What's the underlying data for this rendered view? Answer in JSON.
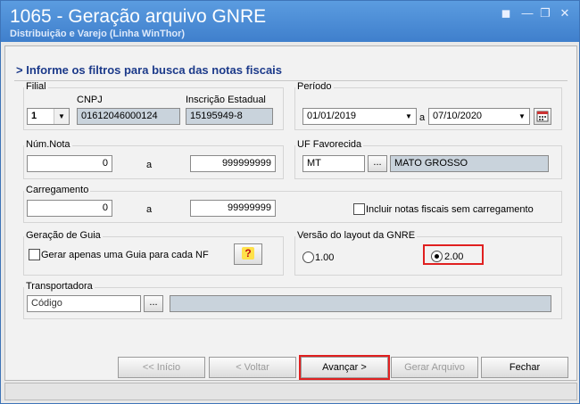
{
  "window": {
    "title": "1065 - Geração arquivo GNRE",
    "subtitle": "Distribuição e Varejo (Linha WinThor)",
    "controls": [
      "minimize",
      "restore",
      "close"
    ]
  },
  "heading": "> Informe os filtros para busca das notas fiscais",
  "filial": {
    "title": "Filial",
    "value": "1",
    "cnpj_label": "CNPJ",
    "cnpj_value": "01612046000124",
    "ie_label": "Inscrição Estadual",
    "ie_value": "15195949-8"
  },
  "periodo": {
    "title": "Período",
    "start": "01/01/2019",
    "sep": "a",
    "end": "07/10/2020"
  },
  "num_nota": {
    "title": "Núm.Nota",
    "from": "0",
    "sep": "a",
    "to": "999999999"
  },
  "uf": {
    "title": "UF Favorecida",
    "code": "MT",
    "button": "...",
    "name": "MATO GROSSO"
  },
  "carregamento": {
    "title": "Carregamento",
    "from": "0",
    "sep": "a",
    "to": "99999999",
    "include_label": "Incluir notas fiscais sem carregamento",
    "include_checked": false
  },
  "geracao": {
    "title": "Geração de Guia",
    "check_label": "Gerar apenas uma Guia para cada NF",
    "checked": false,
    "help_glyph": "?"
  },
  "versao": {
    "title": "Versão do layout da GNRE",
    "option1": "1.00",
    "option2": "2.00",
    "selected": "2.00"
  },
  "transportadora": {
    "title": "Transportadora",
    "placeholder": "Código",
    "button": "..."
  },
  "buttons": {
    "inicio": "<< Início",
    "voltar": "< Voltar",
    "avancar": "Avançar >",
    "gerar": "Gerar Arquivo",
    "fechar": "Fechar"
  },
  "colors": {
    "titlebar": "#4a8bd6",
    "heading": "#1c3a8a",
    "highlight": "#e02020",
    "readonly_field": "#c9d3dc"
  }
}
